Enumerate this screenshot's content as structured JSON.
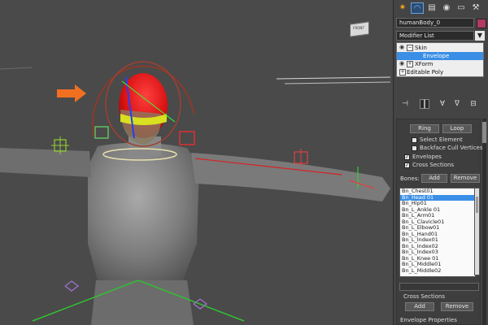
{
  "command_panel": {
    "tabs": [
      "create-tab",
      "modify-tab",
      "hierarchy-tab",
      "motion-tab",
      "display-tab",
      "utilities-tab"
    ],
    "object_name": "humanBody_0",
    "object_color": "#b23a63",
    "modifier_list_label": "Modifier List"
  },
  "modifier_stack": [
    {
      "label": "Skin"
    },
    {
      "label": "Envelope"
    },
    {
      "label": "XForm"
    },
    {
      "label": "Editable Poly"
    }
  ],
  "skin_params": {
    "ring_label": "Ring",
    "loop_label": "Loop",
    "select_element_label": "Select Element",
    "backface_label": "Backface Cull Vertices",
    "envelopes_label": "Envelopes",
    "cross_sections_label": "Cross Sections",
    "bones_label": "Bones:",
    "add_label": "Add",
    "remove_label": "Remove",
    "bones": [
      "Bn_Chest01",
      "Bn_Head 01",
      "Bn_Hip01",
      "Bn_L_Ankle 01",
      "Bn_L_Arm01",
      "Bn_L_Clavicle01",
      "Bn_L_Elbow01",
      "Bn_L_Hand01",
      "Bn_L_Index01",
      "Bn_L_Index02",
      "Bn_L_Index03",
      "Bn_L_Knee 01",
      "Bn_L_Middle01",
      "Bn_L_Middle02"
    ],
    "selected_bone": "Bn_Head 01",
    "cross_sections_header": "Cross Sections",
    "cs_add_label": "Add",
    "cs_remove_label": "Remove",
    "envelope_properties_label": "Envelope Properties"
  },
  "viewcube": {
    "label": "FRONT"
  },
  "colors": {
    "selection": "#3a8ee6",
    "arrow": "#f07020",
    "envelope": "#e01818"
  }
}
